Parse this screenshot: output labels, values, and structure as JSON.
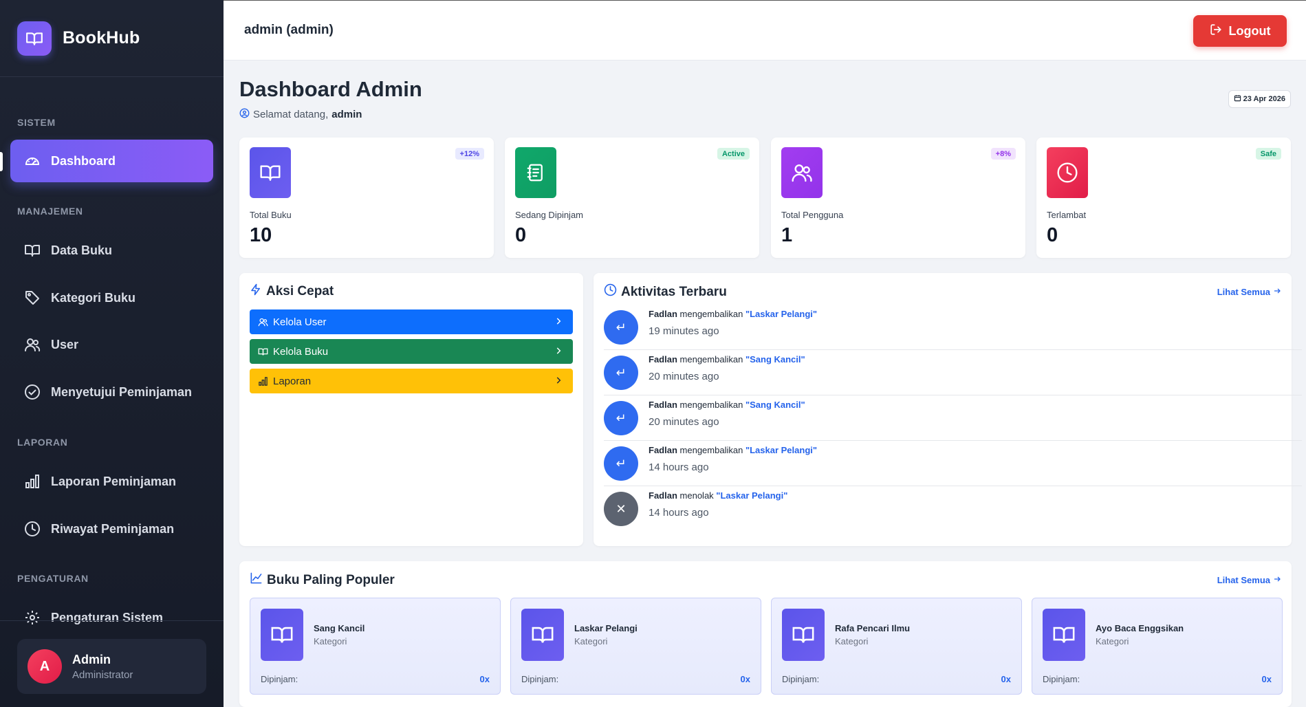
{
  "brand": {
    "name": "BookHub"
  },
  "sidebar": {
    "sections": [
      "SISTEM",
      "MANAJEMEN",
      "LAPORAN",
      "PENGATURAN"
    ],
    "items": [
      {
        "label": "Dashboard",
        "icon": "dashboard-gauge-icon",
        "active": true
      },
      {
        "label": "Data Buku",
        "icon": "book-icon"
      },
      {
        "label": "Kategori Buku",
        "icon": "tag-icon"
      },
      {
        "label": "User",
        "icon": "users-icon"
      },
      {
        "label": "Menyetujui Peminjaman",
        "icon": "check-circle-icon"
      },
      {
        "label": "Laporan Peminjaman",
        "icon": "bar-chart-icon"
      },
      {
        "label": "Riwayat Peminjaman",
        "icon": "clock-icon"
      },
      {
        "label": "Pengaturan Sistem",
        "icon": "gear-icon"
      }
    ],
    "user": {
      "initial": "A",
      "name": "Admin",
      "role": "Administrator"
    }
  },
  "topbar": {
    "user": "admin (admin)",
    "logout_label": "Logout"
  },
  "header": {
    "title": "Dashboard Admin",
    "welcome_prefix": "Selamat datang,",
    "welcome_user": "admin",
    "date": "23 Apr 2026"
  },
  "stats": [
    {
      "label": "Total Buku",
      "value": "10",
      "badge": "+12%",
      "icon": "book-open-icon",
      "color": "#5b55ea",
      "badge_bg": "#e8eaff",
      "badge_fg": "#4f46e5"
    },
    {
      "label": "Sedang Dipinjam",
      "value": "0",
      "badge": "Active",
      "icon": "notebook-icon",
      "color": "#10a86b",
      "badge_bg": "#d7f5e6",
      "badge_fg": "#059669"
    },
    {
      "label": "Total Pengguna",
      "value": "1",
      "badge": "+8%",
      "icon": "users-icon",
      "color": "#a23df0",
      "badge_bg": "#f1e3fd",
      "badge_fg": "#9333ea"
    },
    {
      "label": "Terlambat",
      "value": "0",
      "badge": "Safe",
      "icon": "clock-icon",
      "color": "#ef2b55",
      "badge_bg": "#d7f5e6",
      "badge_fg": "#059669"
    }
  ],
  "quick_actions": {
    "title": "Aksi Cepat",
    "items": [
      {
        "label": "Kelola User",
        "icon": "users-icon",
        "bg": "#0d6efd",
        "fg": "#ffffff"
      },
      {
        "label": "Kelola Buku",
        "icon": "book-icon",
        "bg": "#198754",
        "fg": "#ffffff"
      },
      {
        "label": "Laporan",
        "icon": "bar-chart-icon",
        "bg": "#ffc107",
        "fg": "#1f2937"
      }
    ]
  },
  "activity": {
    "title": "Aktivitas Terbaru",
    "see_all": "Lihat Semua",
    "items": [
      {
        "who": "Fadlan",
        "action": "mengembalikan",
        "book": "\"Laskar Pelangi\"",
        "time": "19 minutes ago",
        "type": "return"
      },
      {
        "who": "Fadlan",
        "action": "mengembalikan",
        "book": "\"Sang Kancil\"",
        "time": "20 minutes ago",
        "type": "return"
      },
      {
        "who": "Fadlan",
        "action": "mengembalikan",
        "book": "\"Sang Kancil\"",
        "time": "20 minutes ago",
        "type": "return"
      },
      {
        "who": "Fadlan",
        "action": "mengembalikan",
        "book": "\"Laskar Pelangi\"",
        "time": "14 hours ago",
        "type": "return"
      },
      {
        "who": "Fadlan",
        "action": "menolak",
        "book": "\"Laskar Pelangi\"",
        "time": "14 hours ago",
        "type": "reject"
      }
    ]
  },
  "popular": {
    "title": "Buku Paling Populer",
    "see_all": "Lihat Semua",
    "items": [
      {
        "title": "Sang Kancil",
        "category": "Kategori",
        "borrow_label": "Dipinjam:",
        "borrow_count": "0x"
      },
      {
        "title": "Laskar Pelangi",
        "category": "Kategori",
        "borrow_label": "Dipinjam:",
        "borrow_count": "0x"
      },
      {
        "title": "Rafa Pencari Ilmu",
        "category": "Kategori",
        "borrow_label": "Dipinjam:",
        "borrow_count": "0x"
      },
      {
        "title": "Ayo Baca Enggsikan",
        "category": "Kategori",
        "borrow_label": "Dipinjam:",
        "borrow_count": "0x"
      }
    ]
  }
}
